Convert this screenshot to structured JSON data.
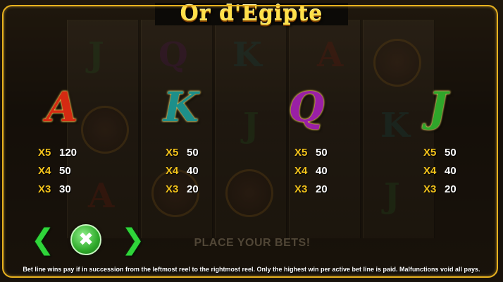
{
  "game": {
    "title": "Or d'Egipte"
  },
  "paytable": [
    {
      "symbol": "A",
      "color": "#d52a12",
      "payouts": [
        {
          "mult": "X5",
          "value": "120"
        },
        {
          "mult": "X4",
          "value": "50"
        },
        {
          "mult": "X3",
          "value": "30"
        }
      ]
    },
    {
      "symbol": "K",
      "color": "#1d8f8a",
      "payouts": [
        {
          "mult": "X5",
          "value": "50"
        },
        {
          "mult": "X4",
          "value": "40"
        },
        {
          "mult": "X3",
          "value": "20"
        }
      ]
    },
    {
      "symbol": "Q",
      "color": "#9a1fa6",
      "payouts": [
        {
          "mult": "X5",
          "value": "50"
        },
        {
          "mult": "X4",
          "value": "40"
        },
        {
          "mult": "X3",
          "value": "20"
        }
      ]
    },
    {
      "symbol": "J",
      "color": "#2fa62a",
      "payouts": [
        {
          "mult": "X5",
          "value": "50"
        },
        {
          "mult": "X4",
          "value": "40"
        },
        {
          "mult": "X3",
          "value": "20"
        }
      ]
    }
  ],
  "controls": {
    "prev_icon": "chevron-left-icon",
    "close_icon": "close-x-icon",
    "next_icon": "chevron-right-icon"
  },
  "background": {
    "status_text": "PLACE YOUR BETS!"
  },
  "footer": {
    "rules_text": "Bet line wins pay if in succession from the leftmost reel to the rightmost reel. Only the highest win per active bet line is paid.  Malfunctions void all pays."
  },
  "colors": {
    "frame": "#e8b21f",
    "title": "#ffe14a",
    "multiplier": "#f2c21b",
    "nav": "#2fd53a"
  }
}
